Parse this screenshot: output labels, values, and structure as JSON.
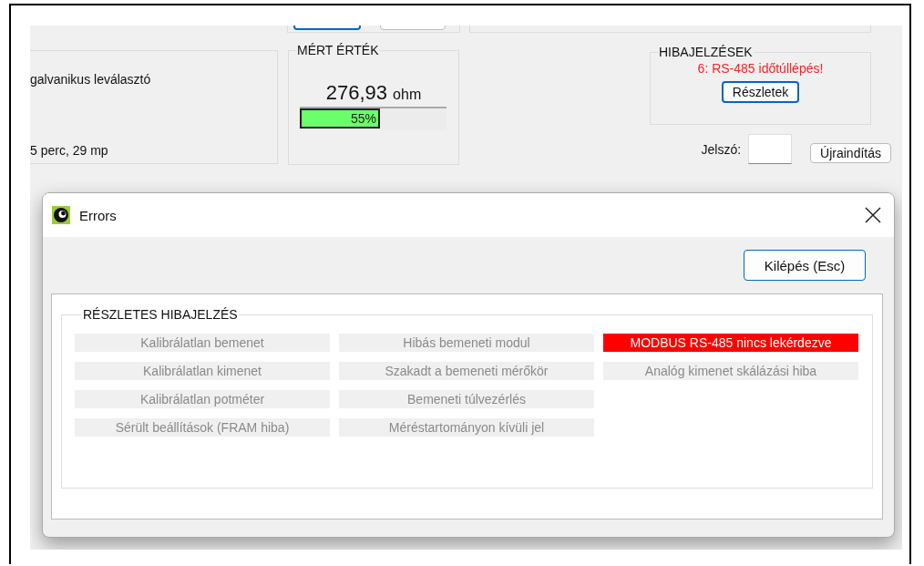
{
  "background_window": {
    "info_panel": {
      "lines": [
        "galvanikus leválasztó",
        "5 perc, 29 mp"
      ]
    },
    "measured_value": {
      "title": "MÉRT ÉRTÉK",
      "value": "276,93",
      "unit": "ohm",
      "level": 0.55,
      "percent": "55%"
    },
    "errors": {
      "title": "HIBAJELZÉSEK",
      "message": "6: RS-485 időtúllépés!",
      "button": "Részletek"
    },
    "password": {
      "label": "Jelszó:"
    },
    "restart_button": "Újraindítás"
  },
  "dialog": {
    "title": "Errors",
    "exit_button": "Kilépés (Esc)",
    "group_title": "RÉSZLETES HIBAJELZÉS",
    "columns": [
      [
        {
          "label": "Kalibrálatlan bemenet",
          "active": false
        },
        {
          "label": "Kalibrálatlan kimenet",
          "active": false
        },
        {
          "label": "Kalibrálatlan potméter",
          "active": false
        },
        {
          "label": "Sérült beállítások (FRAM hiba)",
          "active": false
        }
      ],
      [
        {
          "label": "Hibás bemeneti modul",
          "active": false
        },
        {
          "label": "Szakadt a bemeneti mérőkör",
          "active": false
        },
        {
          "label": "Bemeneti túlvezérlés",
          "active": false
        },
        {
          "label": "Méréstartományon kívüli jel",
          "active": false
        }
      ],
      [
        {
          "label": "MODBUS RS-485 nincs lekérdezve",
          "active": true
        },
        {
          "label": "Analóg kimenet skálázási hiba",
          "active": false
        }
      ]
    ]
  }
}
